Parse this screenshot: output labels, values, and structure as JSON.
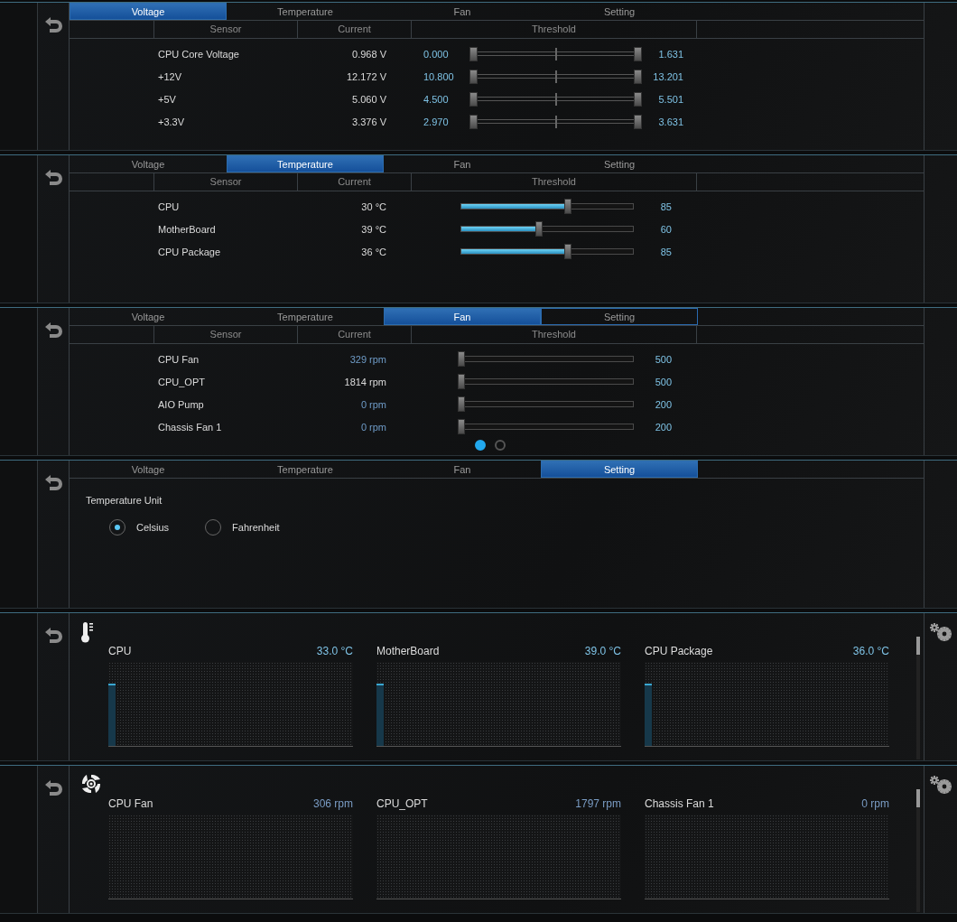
{
  "panels": [
    {
      "kind": "table",
      "tabs": [
        {
          "label": "Voltage",
          "selected": true,
          "outlined": false
        },
        {
          "label": "Temperature",
          "selected": false,
          "outlined": false
        },
        {
          "label": "Fan",
          "selected": false,
          "outlined": false
        },
        {
          "label": "Setting",
          "selected": false,
          "outlined": false
        }
      ],
      "columns": [
        "Sensor",
        "Current",
        "Threshold"
      ],
      "rows": [
        {
          "kind": "range",
          "sensor": "CPU Core Voltage",
          "current": "0.968 V",
          "highlighted": false,
          "low": "0.000",
          "level": 1,
          "high": "1.631"
        },
        {
          "kind": "range",
          "sensor": "+12V",
          "current": "12.172 V",
          "highlighted": false,
          "low": "10.800",
          "level": 1,
          "high": "13.201"
        },
        {
          "kind": "range",
          "sensor": "+5V",
          "current": "5.060 V",
          "highlighted": false,
          "low": "4.500",
          "level": 1,
          "high": "5.501"
        },
        {
          "kind": "range",
          "sensor": "+3.3V",
          "current": "3.376 V",
          "highlighted": false,
          "low": "2.970",
          "level": 1,
          "high": "3.631"
        }
      ]
    },
    {
      "kind": "table",
      "tabs": [
        {
          "label": "Voltage",
          "selected": false,
          "outlined": false
        },
        {
          "label": "Temperature",
          "selected": true,
          "outlined": false
        },
        {
          "label": "Fan",
          "selected": false,
          "outlined": false
        },
        {
          "label": "Setting",
          "selected": false,
          "outlined": false
        }
      ],
      "columns": [
        "Sensor",
        "Current",
        "Threshold"
      ],
      "rows": [
        {
          "kind": "slider",
          "sensor": "CPU",
          "current": "30 °C",
          "highlighted": false,
          "level": 0.62,
          "value": "85"
        },
        {
          "kind": "slider",
          "sensor": "MotherBoard",
          "current": "39 °C",
          "highlighted": false,
          "level": 0.45,
          "value": "60"
        },
        {
          "kind": "slider",
          "sensor": "CPU Package",
          "current": "36 °C",
          "highlighted": false,
          "level": 0.62,
          "value": "85"
        }
      ]
    },
    {
      "kind": "table",
      "tabs": [
        {
          "label": "Voltage",
          "selected": false,
          "outlined": false
        },
        {
          "label": "Temperature",
          "selected": false,
          "outlined": false
        },
        {
          "label": "Fan",
          "selected": true,
          "outlined": false
        },
        {
          "label": "Setting",
          "selected": false,
          "outlined": true
        }
      ],
      "columns": [
        "Sensor",
        "Current",
        "Threshold"
      ],
      "rows": [
        {
          "kind": "slider",
          "sensor": "CPU Fan",
          "current": "329 rpm",
          "highlighted": true,
          "level": 0,
          "value": "500"
        },
        {
          "kind": "slider",
          "sensor": "CPU_OPT",
          "current": "1814 rpm",
          "highlighted": false,
          "level": 0,
          "value": "500"
        },
        {
          "kind": "slider",
          "sensor": "AIO Pump",
          "current": "0 rpm",
          "highlighted": true,
          "level": 0,
          "value": "200"
        },
        {
          "kind": "slider",
          "sensor": "Chassis Fan 1",
          "current": "0 rpm",
          "highlighted": true,
          "level": 0,
          "value": "200"
        }
      ],
      "pages": [
        {
          "selected": true
        },
        {
          "selected": false
        }
      ]
    },
    {
      "kind": "setting",
      "tabs": [
        {
          "label": "Voltage",
          "selected": false,
          "outlined": false
        },
        {
          "label": "Temperature",
          "selected": false,
          "outlined": false
        },
        {
          "label": "Fan",
          "selected": false,
          "outlined": false
        },
        {
          "label": "Setting",
          "selected": true,
          "outlined": false
        }
      ],
      "title": "Temperature Unit",
      "options": [
        {
          "label": "Celsius",
          "selected": true
        },
        {
          "label": "Fahrenheit",
          "selected": false
        }
      ]
    },
    {
      "kind": "temperature_monitor",
      "cards": [
        {
          "name": "CPU",
          "value": "33.0 °C"
        },
        {
          "name": "MotherBoard",
          "value": "39.0 °C"
        },
        {
          "name": "CPU Package",
          "value": "36.0 °C"
        }
      ]
    },
    {
      "kind": "fan_monitor",
      "cards": [
        {
          "name": "CPU Fan",
          "value": "306 rpm"
        },
        {
          "name": "CPU_OPT",
          "value": "1797 rpm"
        },
        {
          "name": "Chassis Fan 1",
          "value": "0 rpm"
        }
      ]
    }
  ]
}
